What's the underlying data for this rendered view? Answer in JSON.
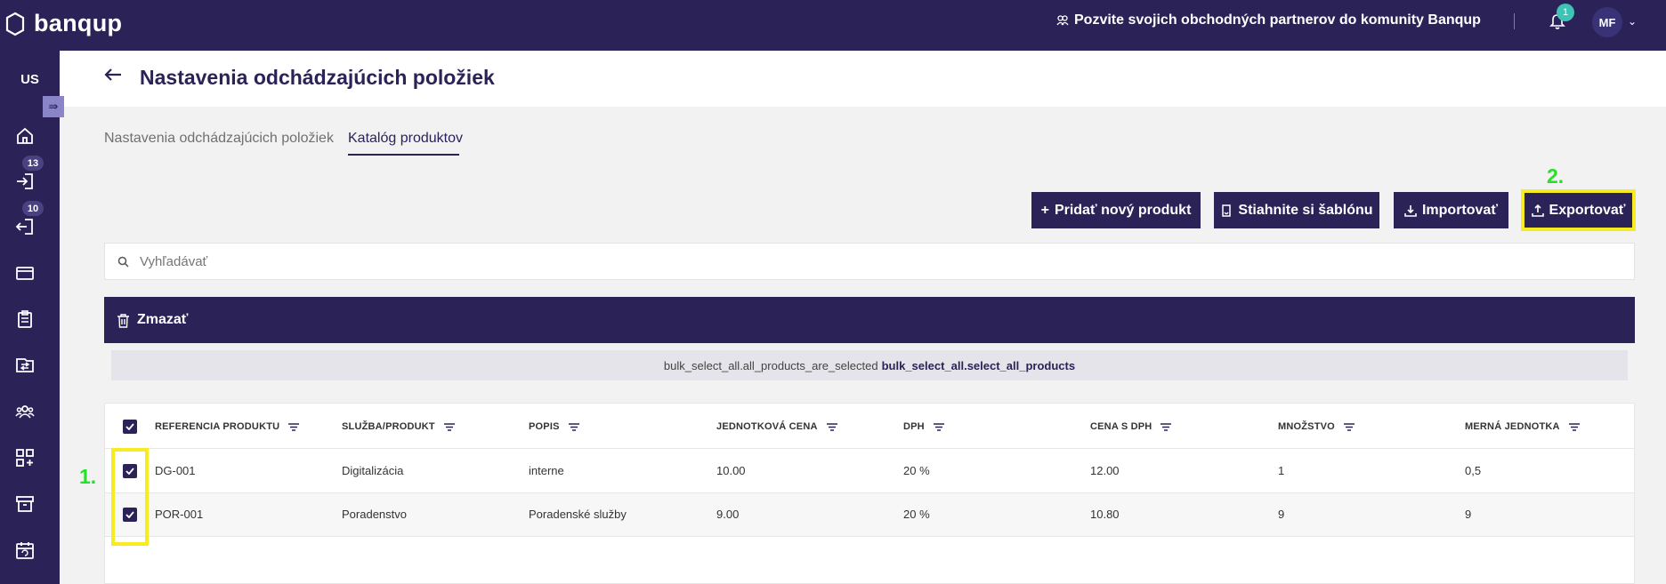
{
  "header": {
    "brand": "banqup",
    "invite_text": "Pozvite svojich obchodných partnerov do komunity Banqup",
    "notification_count": "1",
    "user_initials": "MF"
  },
  "sidebar": {
    "org": "US",
    "badges": {
      "incoming": "13",
      "outgoing": "10"
    }
  },
  "page": {
    "title": "Nastavenia odchádzajúcich položiek",
    "tabs": [
      {
        "label": "Nastavenia odchádzajúcich položiek",
        "active": false
      },
      {
        "label": "Katalóg produktov",
        "active": true
      }
    ]
  },
  "toolbar": {
    "add_label": "Pridať nový produkt",
    "template_label": "Stiahnite si šablónu",
    "import_label": "Importovať",
    "export_label": "Exportovať"
  },
  "annotations": {
    "step1": "1.",
    "step2": "2."
  },
  "search": {
    "placeholder": "Vyhľadávať"
  },
  "bulk": {
    "delete_label": "Zmazať",
    "notice_text": "bulk_select_all.all_products_are_selected",
    "notice_link": "bulk_select_all.select_all_products"
  },
  "table": {
    "columns": [
      "REFERENCIA PRODUKTU",
      "SLUŽBA/PRODUKT",
      "POPIS",
      "JEDNOTKOVÁ CENA",
      "DPH",
      "CENA S DPH",
      "MNOŽSTVO",
      "MERNÁ JEDNOTKA"
    ],
    "rows": [
      [
        "DG-001",
        "Digitalizácia",
        "interne",
        "10.00",
        "20 %",
        "12.00",
        "1",
        "0,5"
      ],
      [
        "POR-001",
        "Poradenstvo",
        "Poradenské služby",
        "9.00",
        "20 %",
        "10.80",
        "9",
        "9"
      ]
    ]
  },
  "colors": {
    "brand": "#2b2358",
    "highlight": "#f6ec1f",
    "step": "#26e02a",
    "badge": "#3fc3b4"
  }
}
